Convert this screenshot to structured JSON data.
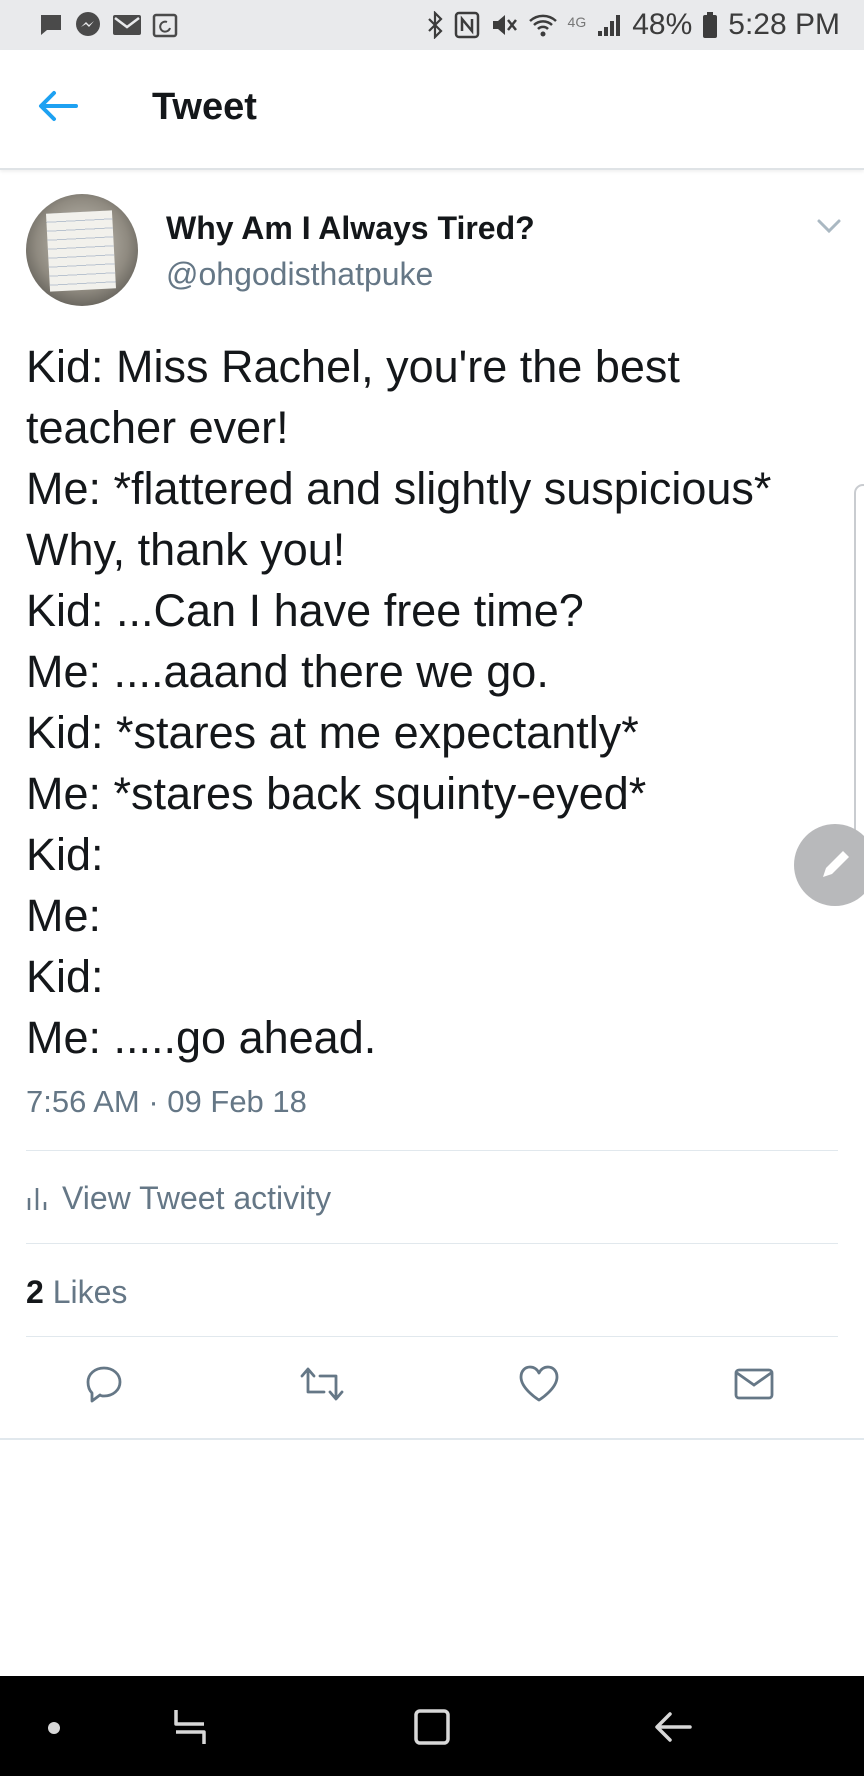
{
  "status_bar": {
    "battery": "48%",
    "time": "5:28 PM",
    "network": "4G",
    "left_icons": [
      "message-icon",
      "messenger-icon",
      "mail-icon",
      "calendar-icon"
    ],
    "right_icons": [
      "bluetooth-icon",
      "nfc-icon",
      "mute-icon",
      "wifi-icon",
      "signal-icon",
      "battery-icon"
    ]
  },
  "header": {
    "title": "Tweet"
  },
  "tweet": {
    "display_name": "Why Am I Always Tired?",
    "handle": "@ohgodisthatpuke",
    "lines": [
      "Kid: Miss Rachel, you're the best",
      "teacher ever!",
      "Me: *flattered and slightly suspicious*",
      "Why, thank you!",
      "Kid: ...Can I have free time?",
      "Me: ....aaand there we go.",
      "Kid: *stares at me expectantly*",
      "Me: *stares back squinty-eyed*",
      "Kid:",
      "Me:",
      "Kid:",
      "Me: .....go ahead."
    ],
    "timestamp": "7:56 AM · 09 Feb 18",
    "activity_label": "View Tweet activity",
    "likes_count": "2",
    "likes_label": "Likes"
  },
  "colors": {
    "accent": "#1da1f2",
    "secondary_text": "#657786",
    "primary_text": "#14171a"
  }
}
